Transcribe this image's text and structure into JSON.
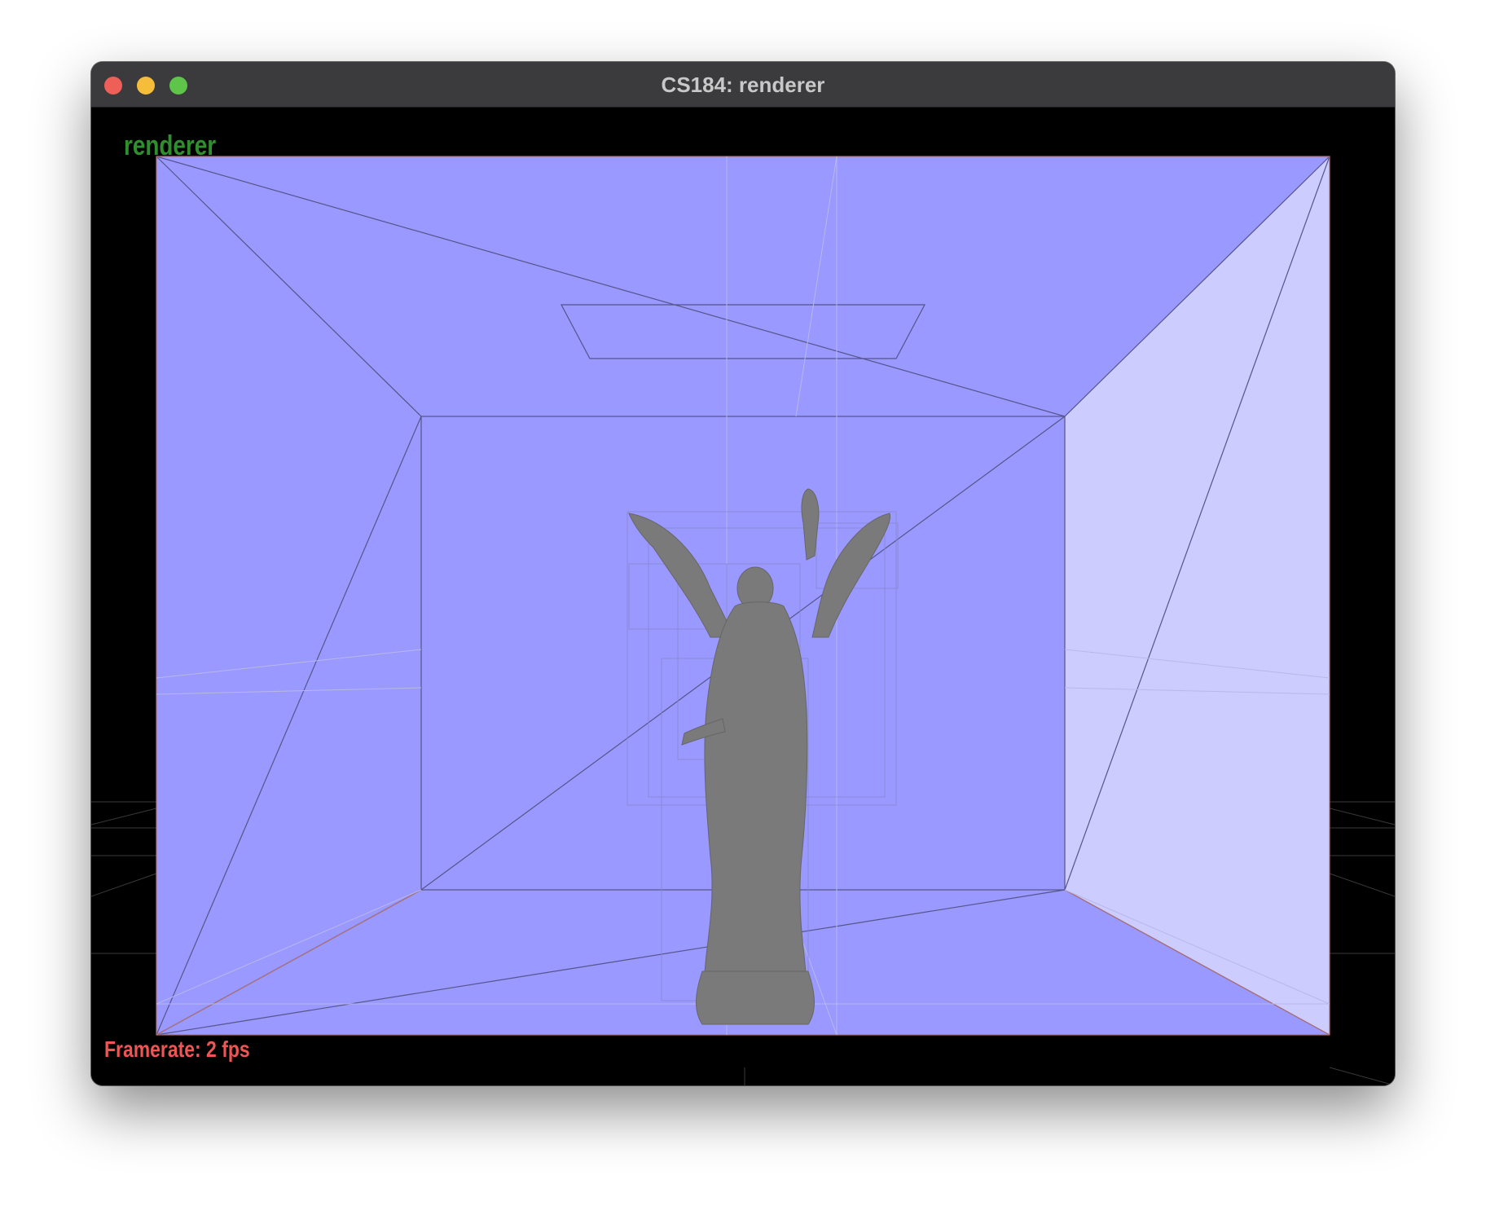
{
  "window": {
    "title": "CS184: renderer"
  },
  "viewport": {
    "scene_label": "renderer",
    "framerate_text": "Framerate: 2 fps",
    "room_color": "#9999ff",
    "light_wall_color": "#ccccff",
    "mesh_color": "#7a7a7a"
  }
}
